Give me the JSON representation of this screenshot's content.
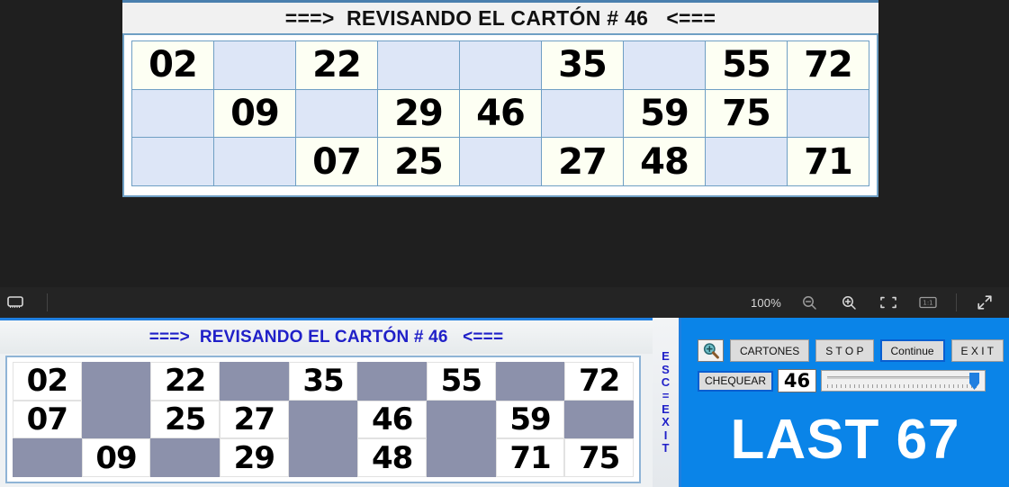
{
  "top_preview": {
    "title": "===>  REVISANDO EL CARTÓN # 46   <===",
    "card": {
      "rows": [
        [
          "02",
          "",
          "22",
          "",
          "",
          "35",
          "",
          "55",
          "72"
        ],
        [
          "",
          "09",
          "",
          "29",
          "46",
          "",
          "59",
          "75",
          ""
        ],
        [
          "",
          "",
          "07",
          "25",
          "",
          "27",
          "48",
          "",
          "71"
        ]
      ]
    }
  },
  "toolbar": {
    "screen_icon": "monitor-icon",
    "zoom_level": "100%",
    "zoom_out_icon": "zoom-out-icon",
    "zoom_in_icon": "zoom-in-icon",
    "fit_screen_icon": "fit-screen-icon",
    "actual_size_icon": "actual-size-icon",
    "expand_icon": "expand-icon"
  },
  "app": {
    "title": "===>  REVISANDO EL CARTÓN # 46   <===",
    "card": {
      "rows": [
        [
          "02",
          "",
          "22",
          "",
          "35",
          "",
          "55",
          "",
          "72"
        ],
        [
          "07",
          "",
          "25",
          "27",
          "",
          "46",
          "",
          "59",
          ""
        ],
        [
          "",
          "09",
          "",
          "29",
          "",
          "48",
          "",
          "71",
          "75"
        ]
      ]
    },
    "esc_exit_letters": [
      "E",
      "S",
      "C",
      "=",
      "E",
      "X",
      "I",
      "T"
    ],
    "controls": {
      "magnifier_icon": "magnifier-plus-icon",
      "cartones_label": "CARTONES",
      "stop_label": "S T O P",
      "continue_label": "Continue",
      "exit_label": "E X I T",
      "chequear_label": "CHEQUEAR",
      "number_value": "46",
      "slider_name": "speed-slider"
    },
    "last_banner": "LAST 67"
  },
  "colors": {
    "accent_blue": "#0a84e8",
    "title_blue": "#2020c8",
    "card_empty_top": "#dde6f7",
    "card_filled_top": "#fdfff3",
    "card_empty_bottom": "#8c91ab",
    "card_filled_bottom": "#ffffff",
    "toolbar_bg": "#242424",
    "page_bg": "#1f1f1f"
  }
}
